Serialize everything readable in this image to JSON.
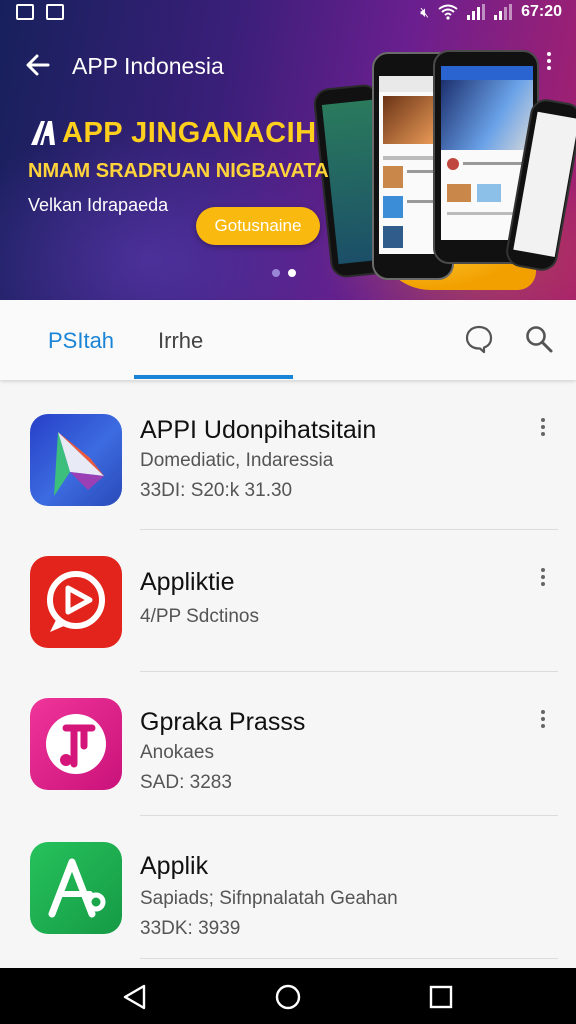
{
  "status_bar": {
    "time": "67:20",
    "icons": [
      "image-icon",
      "news-icon",
      "mute-icon",
      "wifi-icon",
      "signal-icon",
      "battery-icon"
    ]
  },
  "app_bar": {
    "title": "APP Indonesia",
    "back_icon": "arrow-left-icon",
    "menu_icon": "more-vert-icon"
  },
  "promo": {
    "heading": "APP JINGANACIH",
    "subheading": "NMAM SRADRUAN NIGBAVATA",
    "tagline": "Velkan Idrapaeda",
    "button_label": "Gotusnaine",
    "pages": 2,
    "active_page": 2
  },
  "tabs": [
    {
      "label": "PSItah",
      "active": true
    },
    {
      "label": "Irrhe",
      "active": false
    }
  ],
  "tab_icons": [
    "chat-icon",
    "search-icon"
  ],
  "apps": [
    {
      "name": "APPI Udonpihatsitain",
      "line1": "Domediatic, Indaressia",
      "line2": "33DI: S20:k 31.30",
      "icon": "paper-plane-icon",
      "colors": [
        "#2f49c4",
        "#31b477",
        "#e0493f"
      ]
    },
    {
      "name": "Appliktie",
      "line1": "4/PP Sdctinos",
      "line2": "",
      "icon": "play-bubble-icon",
      "colors": [
        "#e3241c"
      ]
    },
    {
      "name": "Gpraka Prasss",
      "line1": "Anokaes",
      "line2": "SAD: 3283",
      "icon": "music-note-icon",
      "colors": [
        "#d4157a",
        "#f02b96"
      ]
    },
    {
      "name": "Applik",
      "line1": "Sapiads; Sifnpnalatah Geahan",
      "line2": "33DK: 3939",
      "icon": "connector-a-icon",
      "colors": [
        "#1fa84c",
        "#23c15a"
      ]
    }
  ],
  "nav_bar": {
    "buttons": [
      "back-triangle-icon",
      "home-circle-icon",
      "recents-square-icon"
    ]
  },
  "colors": {
    "accent": "#1a84d6",
    "promo_yellow": "#ffcf1d",
    "promo_button": "#f9b90e"
  }
}
